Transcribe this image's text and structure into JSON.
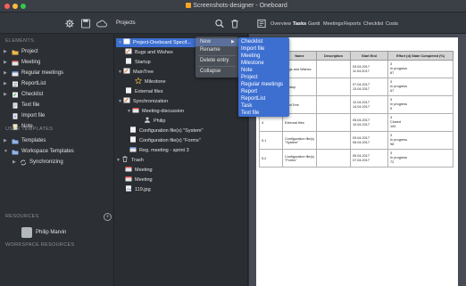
{
  "window": {
    "title": "Screenshots-designer - Oneboard"
  },
  "toolbar": {
    "projects_label": "Projects",
    "tabs": [
      "Overview",
      "Tasks",
      "Gantt",
      "Meetings",
      "Reports",
      "Checklist",
      "Costs"
    ],
    "active_tab": "Tasks"
  },
  "sidebar": {
    "elements_heading": "ELEMENTS",
    "items": [
      {
        "label": "Project",
        "icon": "folder-icon"
      },
      {
        "label": "Meeting",
        "icon": "calendar-icon"
      },
      {
        "label": "Regular meetings",
        "icon": "calendar-repeat-icon"
      },
      {
        "label": "ReportList",
        "icon": "report-icon"
      },
      {
        "label": "Checklist",
        "icon": "checklist-icon"
      },
      {
        "label": "Text file",
        "icon": "text-file-icon"
      },
      {
        "label": "Import file",
        "icon": "import-icon"
      },
      {
        "label": "Note",
        "icon": "note-icon"
      }
    ],
    "user_templates_heading": "USER TEMPLATES",
    "templates_label": "Templates",
    "workspace_templates_label": "Workspace Templates",
    "synchronizing_label": "Synchronizing",
    "resources_heading": "RESOURCES",
    "resource_user": "Philip Marvin",
    "workspace_resources_heading": "WORKSPACE RESOURCES"
  },
  "tree": {
    "items": [
      {
        "label": "Project-Oneboard Specif...",
        "icon": "project-icon",
        "selected": true
      },
      {
        "label": "Bugs and Wishes",
        "icon": "pencil-icon"
      },
      {
        "label": "Startup",
        "icon": "page-icon"
      },
      {
        "label": "MainTree",
        "icon": "pencil-icon"
      },
      {
        "label": "Milestone",
        "icon": "star-icon"
      },
      {
        "label": "External files",
        "icon": "page-icon"
      },
      {
        "label": "Synchronization",
        "icon": "pencil-icon"
      },
      {
        "label": "Meeting-discussion",
        "icon": "calendar-icon"
      },
      {
        "label": "Philip",
        "icon": "person-icon"
      },
      {
        "label": "Configuration file(s) \"System\"",
        "icon": "page-icon"
      },
      {
        "label": "Configuration file(s) \"Forms\"",
        "icon": "page-icon"
      },
      {
        "label": "Reg. meeting - sprint 3",
        "icon": "calendar-repeat-icon"
      },
      {
        "label": "Trash",
        "icon": "trash-icon"
      },
      {
        "label": "Meeting",
        "icon": "calendar-icon"
      },
      {
        "label": "Meeting",
        "icon": "calendar-icon"
      },
      {
        "label": "119.jpg",
        "icon": "image-icon"
      }
    ]
  },
  "context_menu": {
    "items": [
      "New",
      "Rename",
      "Delete entry",
      "Collapse"
    ]
  },
  "submenu": {
    "items": [
      "Checklist",
      "Import file",
      "Meeting",
      "Milestone",
      "Note",
      "Project",
      "Regular meetings",
      "Report",
      "ReportList",
      "Task",
      "Text file"
    ]
  },
  "table": {
    "headers": [
      "",
      "Name",
      "Description",
      "Start End",
      "Effort (d) State Completed (%)"
    ],
    "rows": [
      {
        "num": "1",
        "name": "Bugs and Wishes",
        "desc": "",
        "dates": [
          "03.04.2017",
          "11.04.2017"
        ],
        "effort": [
          "3",
          "In progress",
          "87"
        ]
      },
      {
        "num": "2",
        "name": "Startup",
        "desc": "",
        "dates": [
          "07.04.2017",
          "13.04.2017"
        ],
        "effort": [
          "3",
          "In progress",
          "67"
        ]
      },
      {
        "num": "3",
        "name": "MainTree",
        "desc": "",
        "dates": [
          "12.04.2017",
          "14.04.2017"
        ],
        "effort": [
          "3",
          "In progress",
          "5"
        ]
      },
      {
        "num": "4",
        "name": "External files",
        "desc": "",
        "dates": [
          "05.04.2017",
          "10.04.2017"
        ],
        "effort": [
          "3",
          "Closed",
          "100"
        ]
      },
      {
        "num": "5.1",
        "name": "Configuration file(s) \"System\"",
        "desc": "",
        "dates": [
          "03.04.2017",
          "06.04.2017"
        ],
        "effort": [
          "3",
          "In progress",
          "98"
        ]
      },
      {
        "num": "5.2",
        "name": "Configuration file(s) \"Forms\"",
        "desc": "",
        "dates": [
          "05.04.2017",
          "07.04.2017"
        ],
        "effort": [
          "3",
          "In progress",
          "72"
        ]
      }
    ]
  },
  "colors": {
    "selection": "#3d6fd1",
    "traffic_red": "#fc605c",
    "traffic_yellow": "#fdbc40",
    "traffic_green": "#34c84a"
  }
}
